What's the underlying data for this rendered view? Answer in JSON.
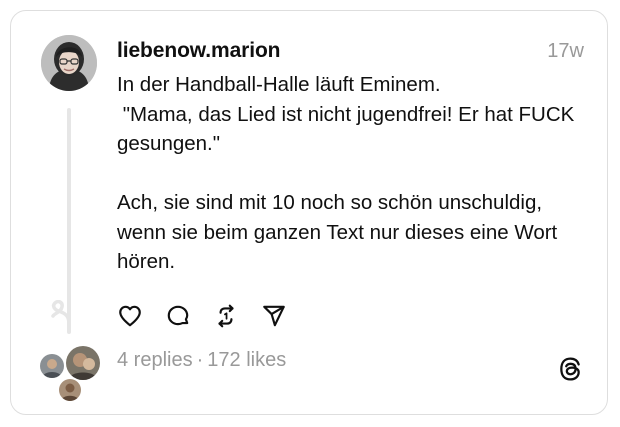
{
  "post": {
    "username": "liebenow.marion",
    "timestamp": "17w",
    "text": "In der Handball-Halle läuft Eminem.\n \"Mama, das Lied ist nicht jugendfrei! Er hat FUCK gesungen.\"\n\nAch, sie sind mit 10 noch so schön unschuldig, wenn sie beim ganzen Text nur dieses eine Wort hören."
  },
  "actions": {
    "like_icon": "heart-icon",
    "reply_icon": "comment-icon",
    "repost_icon": "repost-icon",
    "share_icon": "send-icon"
  },
  "stats": {
    "replies": "4 replies",
    "separator": "·",
    "likes": "172 likes"
  },
  "colors": {
    "text": "#101010",
    "muted": "#999999",
    "border": "#dedede",
    "thread_line": "#e6e6e6"
  }
}
